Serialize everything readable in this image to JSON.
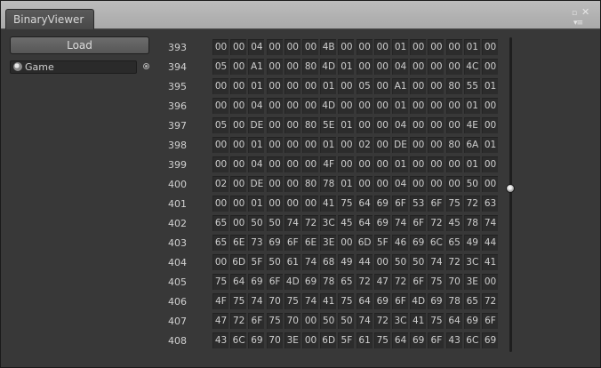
{
  "window": {
    "tab_title": "BinaryViewer",
    "controls": {
      "maximize": "▫",
      "close": "✕",
      "menu": "▾≡"
    }
  },
  "toolbar": {
    "load_label": "Load",
    "object_field_value": "Game",
    "object_field_icon": "scene-icon",
    "picker_icon": "object-picker-icon"
  },
  "scrollbar": {
    "position_fraction": 0.48
  },
  "rows": [
    {
      "index": "393",
      "bytes": [
        "00",
        "00",
        "04",
        "00",
        "00",
        "00",
        "4B",
        "00",
        "00",
        "00",
        "01",
        "00",
        "00",
        "00",
        "01",
        "00"
      ]
    },
    {
      "index": "394",
      "bytes": [
        "05",
        "00",
        "A1",
        "00",
        "00",
        "80",
        "4D",
        "01",
        "00",
        "00",
        "04",
        "00",
        "00",
        "00",
        "4C",
        "00"
      ]
    },
    {
      "index": "395",
      "bytes": [
        "00",
        "00",
        "01",
        "00",
        "00",
        "00",
        "01",
        "00",
        "05",
        "00",
        "A1",
        "00",
        "00",
        "80",
        "55",
        "01"
      ]
    },
    {
      "index": "396",
      "bytes": [
        "00",
        "00",
        "04",
        "00",
        "00",
        "00",
        "4D",
        "00",
        "00",
        "00",
        "01",
        "00",
        "00",
        "00",
        "01",
        "00"
      ]
    },
    {
      "index": "397",
      "bytes": [
        "05",
        "00",
        "DE",
        "00",
        "00",
        "80",
        "5E",
        "01",
        "00",
        "00",
        "04",
        "00",
        "00",
        "00",
        "4E",
        "00"
      ]
    },
    {
      "index": "398",
      "bytes": [
        "00",
        "00",
        "01",
        "00",
        "00",
        "00",
        "01",
        "00",
        "02",
        "00",
        "DE",
        "00",
        "00",
        "80",
        "6A",
        "01"
      ]
    },
    {
      "index": "399",
      "bytes": [
        "00",
        "00",
        "04",
        "00",
        "00",
        "00",
        "4F",
        "00",
        "00",
        "00",
        "01",
        "00",
        "00",
        "00",
        "01",
        "00"
      ]
    },
    {
      "index": "400",
      "bytes": [
        "02",
        "00",
        "DE",
        "00",
        "00",
        "80",
        "78",
        "01",
        "00",
        "00",
        "04",
        "00",
        "00",
        "00",
        "50",
        "00"
      ]
    },
    {
      "index": "401",
      "bytes": [
        "00",
        "00",
        "01",
        "00",
        "00",
        "00",
        "41",
        "75",
        "64",
        "69",
        "6F",
        "53",
        "6F",
        "75",
        "72",
        "63"
      ]
    },
    {
      "index": "402",
      "bytes": [
        "65",
        "00",
        "50",
        "50",
        "74",
        "72",
        "3C",
        "45",
        "64",
        "69",
        "74",
        "6F",
        "72",
        "45",
        "78",
        "74"
      ]
    },
    {
      "index": "403",
      "bytes": [
        "65",
        "6E",
        "73",
        "69",
        "6F",
        "6E",
        "3E",
        "00",
        "6D",
        "5F",
        "46",
        "69",
        "6C",
        "65",
        "49",
        "44"
      ]
    },
    {
      "index": "404",
      "bytes": [
        "00",
        "6D",
        "5F",
        "50",
        "61",
        "74",
        "68",
        "49",
        "44",
        "00",
        "50",
        "50",
        "74",
        "72",
        "3C",
        "41"
      ]
    },
    {
      "index": "405",
      "bytes": [
        "75",
        "64",
        "69",
        "6F",
        "4D",
        "69",
        "78",
        "65",
        "72",
        "47",
        "72",
        "6F",
        "75",
        "70",
        "3E",
        "00"
      ]
    },
    {
      "index": "406",
      "bytes": [
        "4F",
        "75",
        "74",
        "70",
        "75",
        "74",
        "41",
        "75",
        "64",
        "69",
        "6F",
        "4D",
        "69",
        "78",
        "65",
        "72"
      ]
    },
    {
      "index": "407",
      "bytes": [
        "47",
        "72",
        "6F",
        "75",
        "70",
        "00",
        "50",
        "50",
        "74",
        "72",
        "3C",
        "41",
        "75",
        "64",
        "69",
        "6F"
      ]
    },
    {
      "index": "408",
      "bytes": [
        "43",
        "6C",
        "69",
        "70",
        "3E",
        "00",
        "6D",
        "5F",
        "61",
        "75",
        "64",
        "69",
        "6F",
        "43",
        "6C",
        "69"
      ]
    }
  ]
}
